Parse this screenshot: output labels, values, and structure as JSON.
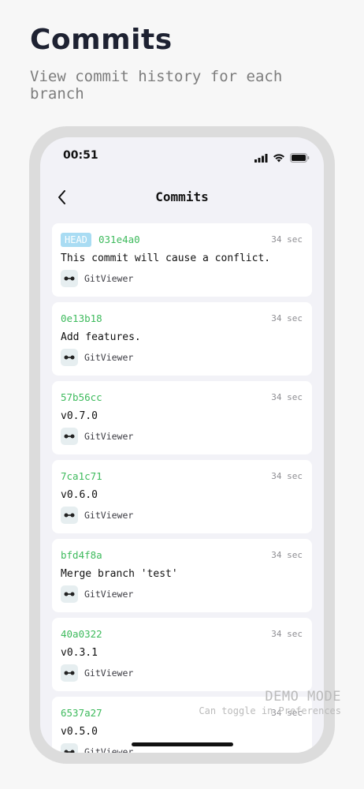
{
  "promo": {
    "title": "Commits",
    "subtitle": "View commit history for each branch"
  },
  "status_bar": {
    "time": "00:51",
    "icons": [
      "cellular-signal-icon",
      "wifi-icon",
      "battery-icon"
    ]
  },
  "nav": {
    "title": "Commits",
    "back_icon": "chevron-left-icon"
  },
  "commits": [
    {
      "head": "HEAD",
      "hash": "031e4a0",
      "time": "34 sec",
      "message": "This commit will cause a conflict.",
      "author": "GitViewer"
    },
    {
      "hash": "0e13b18",
      "time": "34 sec",
      "message": "Add features.",
      "author": "GitViewer"
    },
    {
      "hash": "57b56cc",
      "time": "34 sec",
      "message": "v0.7.0",
      "author": "GitViewer"
    },
    {
      "hash": "7ca1c71",
      "time": "34 sec",
      "message": "v0.6.0",
      "author": "GitViewer"
    },
    {
      "hash": "bfd4f8a",
      "time": "34 sec",
      "message": "Merge branch 'test'",
      "author": "GitViewer"
    },
    {
      "hash": "40a0322",
      "time": "34 sec",
      "message": "v0.3.1",
      "author": "GitViewer"
    },
    {
      "hash": "6537a27",
      "time": "34 sec",
      "message": "v0.5.0",
      "author": "GitViewer"
    }
  ],
  "demo": {
    "title": "DEMO MODE",
    "subtitle": "Can toggle in Preferences"
  },
  "colors": {
    "hash_green": "#3dba5c",
    "head_badge_blue": "#a9dcf3",
    "title_navy": "#1e2232"
  }
}
